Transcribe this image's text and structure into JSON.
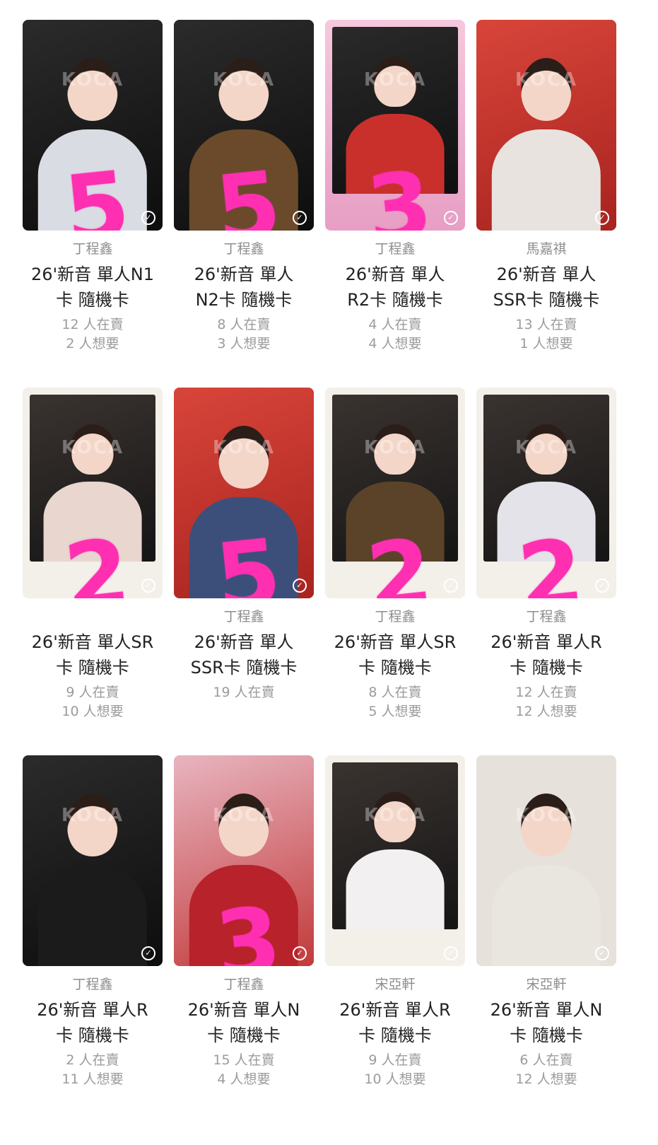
{
  "cards": [
    {
      "member": "丁程鑫",
      "title": "26'新音 單人N1\n卡 隨機卡",
      "selling": "12 人在賣",
      "wanting": "2 人想要",
      "handwritten": "5",
      "photo_style": "dark",
      "top_color": "#d9dde3"
    },
    {
      "member": "丁程鑫",
      "title": "26'新音 單人\nN2卡 隨機卡",
      "selling": "8 人在賣",
      "wanting": "3 人想要",
      "handwritten": "5",
      "photo_style": "dark",
      "top_color": "#6a4a2a"
    },
    {
      "member": "丁程鑫",
      "title": "26'新音 單人\nR2卡 隨機卡",
      "selling": "4 人在賣",
      "wanting": "4 人想要",
      "handwritten": "3",
      "photo_style": "pink",
      "top_color": "#c9302c"
    },
    {
      "member": "馬嘉祺",
      "title": "26'新音 單人\nSSR卡 隨機卡",
      "selling": "13 人在賣",
      "wanting": "1 人想要",
      "handwritten": "",
      "photo_style": "red",
      "top_color": "#e8e3de"
    },
    {
      "member": "",
      "title": "26'新音 單人SR\n卡 隨機卡",
      "selling": "9 人在賣",
      "wanting": "10 人想要",
      "handwritten": "2",
      "photo_style": "white",
      "top_color": "#e8d6cf"
    },
    {
      "member": "丁程鑫",
      "title": "26'新音 單人\nSSR卡 隨機卡",
      "selling": "19 人在賣",
      "wanting": "",
      "handwritten": "5",
      "photo_style": "red",
      "top_color": "#3c4f7a"
    },
    {
      "member": "丁程鑫",
      "title": "26'新音 單人SR\n卡 隨機卡",
      "selling": "8 人在賣",
      "wanting": "5 人想要",
      "handwritten": "2",
      "photo_style": "white",
      "top_color": "#5a4328"
    },
    {
      "member": "丁程鑫",
      "title": "26'新音 單人R\n卡 隨機卡",
      "selling": "12 人在賣",
      "wanting": "12 人想要",
      "handwritten": "2",
      "photo_style": "white",
      "top_color": "#e5e3ea"
    },
    {
      "member": "丁程鑫",
      "title": "26'新音 單人R\n卡 隨機卡",
      "selling": "2 人在賣",
      "wanting": "11 人想要",
      "handwritten": "",
      "photo_style": "dark",
      "top_color": "#1b1b1b"
    },
    {
      "member": "丁程鑫",
      "title": "26'新音 單人N\n卡 隨機卡",
      "selling": "15 人在賣",
      "wanting": "4 人想要",
      "handwritten": "3",
      "photo_style": "pinkred",
      "top_color": "#b8222a"
    },
    {
      "member": "宋亞軒",
      "title": "26'新音 單人R\n卡 隨機卡",
      "selling": "9 人在賣",
      "wanting": "10 人想要",
      "handwritten": "",
      "photo_style": "white",
      "top_color": "#f2f0f0"
    },
    {
      "member": "宋亞軒",
      "title": "26'新音 單人N\n卡 隨機卡",
      "selling": "6 人在賣",
      "wanting": "12 人想要",
      "handwritten": "",
      "photo_style": "beige",
      "top_color": "#e9e5df"
    }
  ],
  "icons": {
    "selected": "check-circle-icon"
  },
  "colors": {
    "handwriting": "#ff2fb2",
    "muted_text": "#9b9b9b",
    "title_text": "#222222"
  }
}
